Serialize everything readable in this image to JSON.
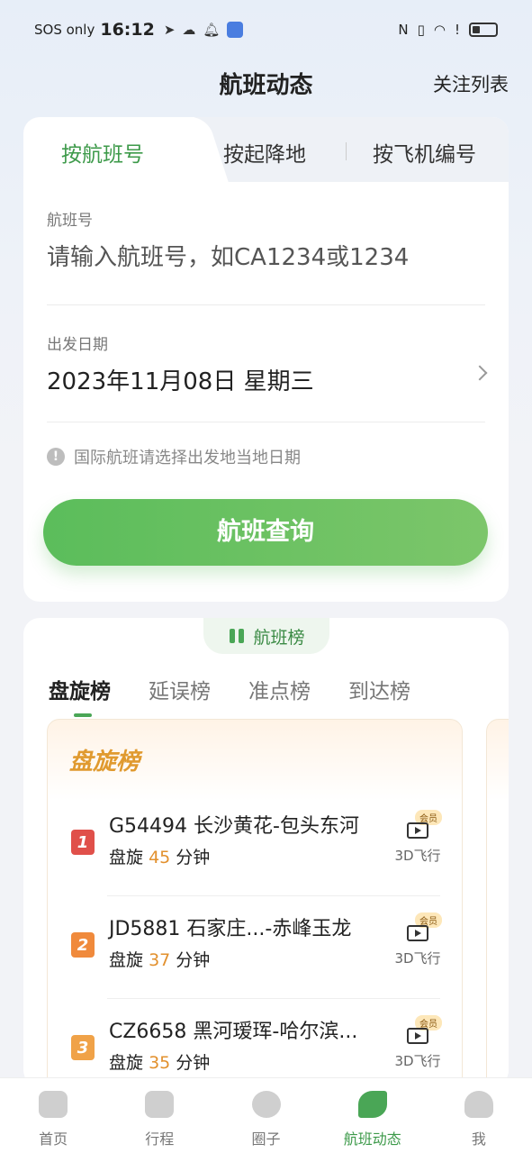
{
  "status_bar": {
    "carrier": "SOS only",
    "time": "16:12"
  },
  "header": {
    "title": "航班动态",
    "follow_list": "关注列表"
  },
  "search_tabs": [
    {
      "label": "按航班号",
      "active": true
    },
    {
      "label": "按起降地",
      "active": false
    },
    {
      "label": "按飞机编号",
      "active": false
    }
  ],
  "flight_field": {
    "label": "航班号",
    "placeholder": "请输入航班号，如CA1234或1234"
  },
  "date_field": {
    "label": "出发日期",
    "value": "2023年11月08日  星期三"
  },
  "notice": "国际航班请选择出发地当地日期",
  "search_button": "航班查询",
  "ranking": {
    "badge": "航班榜",
    "tabs": [
      "盘旋榜",
      "延误榜",
      "准点榜",
      "到达榜"
    ],
    "panel_title": "盘旋榜",
    "rows": [
      {
        "rank": "1",
        "color": "#e0504a",
        "flight": "G54494 长沙黄花-包头东河",
        "hold_prefix": "盘旋",
        "minutes": "45",
        "unit": "分钟",
        "vip": "会员",
        "label_3d": "3D飞行"
      },
      {
        "rank": "2",
        "color": "#f08a3c",
        "flight": "JD5881 石家庄...-赤峰玉龙",
        "hold_prefix": "盘旋",
        "minutes": "37",
        "unit": "分钟",
        "vip": "会员",
        "label_3d": "3D飞行"
      },
      {
        "rank": "3",
        "color": "#f0a248",
        "flight": "CZ6658 黑河瑷珲-哈尔滨...",
        "hold_prefix": "盘旋",
        "minutes": "35",
        "unit": "分钟",
        "vip": "会员",
        "label_3d": "3D飞行"
      }
    ]
  },
  "bottom_nav": [
    {
      "label": "首页",
      "icon": "home-icon",
      "active": false
    },
    {
      "label": "行程",
      "icon": "luggage-icon",
      "active": false
    },
    {
      "label": "圈子",
      "icon": "community-icon",
      "active": false
    },
    {
      "label": "航班动态",
      "icon": "plane-icon",
      "active": true
    },
    {
      "label": "我",
      "icon": "user-icon",
      "active": false
    }
  ]
}
